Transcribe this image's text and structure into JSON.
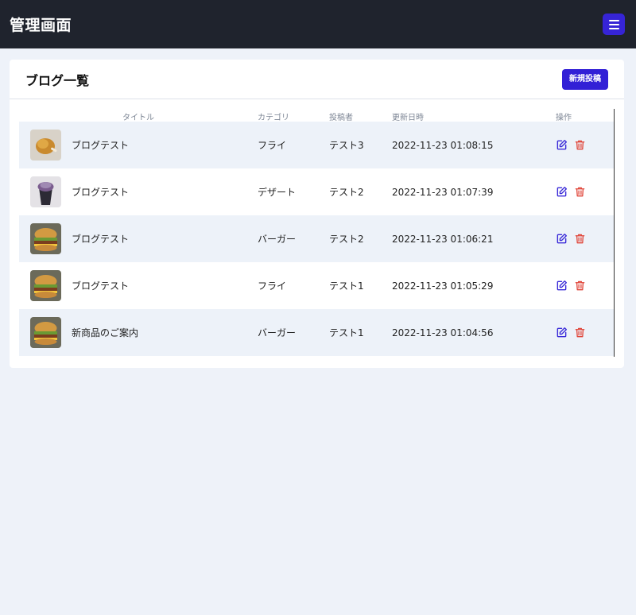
{
  "header": {
    "title": "管理画面",
    "menu_icon": "hamburger-menu-icon"
  },
  "page": {
    "title": "ブログ一覧",
    "new_button": "新規投稿"
  },
  "table": {
    "columns": [
      "タイトル",
      "カテゴリ",
      "投稿者",
      "更新日時",
      "操作"
    ],
    "rows": [
      {
        "thumbnail": "fried-chicken-image",
        "title": "ブログテスト",
        "category": "フライ",
        "author": "テスト3",
        "updated": "2022-11-23 01:08:15"
      },
      {
        "thumbnail": "dessert-cup-image",
        "title": "ブログテスト",
        "category": "デザート",
        "author": "テスト2",
        "updated": "2022-11-23 01:07:39"
      },
      {
        "thumbnail": "burger-image",
        "title": "ブログテスト",
        "category": "バーガー",
        "author": "テスト2",
        "updated": "2022-11-23 01:06:21"
      },
      {
        "thumbnail": "burger-image",
        "title": "ブログテスト",
        "category": "フライ",
        "author": "テスト1",
        "updated": "2022-11-23 01:05:29"
      },
      {
        "thumbnail": "burger-image",
        "title": "新商品のご案内",
        "category": "バーガー",
        "author": "テスト1",
        "updated": "2022-11-23 01:04:56"
      }
    ]
  },
  "colors": {
    "topbar": "#1f232d",
    "accent": "#3220d6",
    "edit": "#3a2bd8",
    "delete": "#e0463a",
    "row_alt": "#edf2f9",
    "background": "#eef2f9"
  }
}
